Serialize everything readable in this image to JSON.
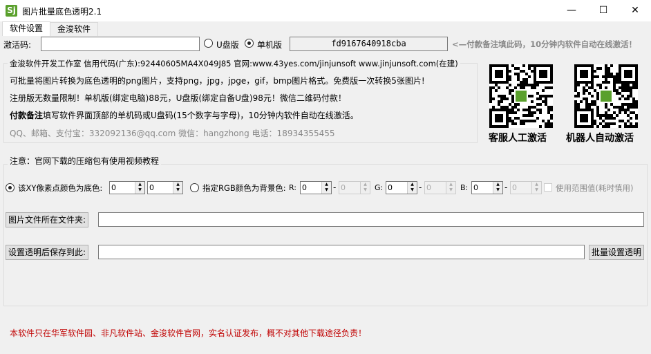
{
  "window": {
    "title": "图片批量底色透明2.1",
    "icon_text": "Sj",
    "minimize": "—",
    "maximize": "☐",
    "close": "✕"
  },
  "tabs": [
    {
      "label": "软件设置"
    },
    {
      "label": "金浚软件"
    }
  ],
  "activation": {
    "label": "激活码:",
    "value": "",
    "usb_label": "U盘版",
    "pc_label": "单机版",
    "selected": "单机版",
    "machine_code": "fd9167640918cba",
    "hint": "<—付款备注填此码，10分钟内软件自动在线激活！"
  },
  "info": {
    "legend": "金浚软件开发工作室 信用代码(广东):92440605MA4X049J85 官网:www.43yes.com/jinjunsoft  www.jinjunsoft.com(在建)",
    "line1": "可批量将图片转换为底色透明的png图片，支持png，jpg，jpge，gif，bmp图片格式。免费版一次转换5张图片!",
    "line2": "注册版无数量限制！单机版(绑定电脑)88元，U盘版(绑定自备U盘)98元！微信二维码付款！",
    "line3_bold": "付款备注",
    "line3_rest": "填写软件界面顶部的单机码或U盘码(15个数字与字母)，10分钟内软件自动在线激活。",
    "contact": "QQ、邮箱、支付宝：332092136@qq.com   微信：hangzhong   电话：18934355455",
    "qr1_label": "客服人工激活",
    "qr2_label": "机器人自动激活"
  },
  "settings": {
    "legend": "注意：官网下载的压缩包有使用视频教程",
    "radio_xy": "该XY像素点颜色为底色:",
    "x": "0",
    "y": "0",
    "radio_rgb": "指定RGB颜色为背景色:",
    "r_label": "R:",
    "g_label": "G:",
    "b_label": "B:",
    "r1": "0",
    "r2": "0",
    "g1": "0",
    "g2": "0",
    "b1": "0",
    "b2": "0",
    "dash": "-",
    "range_label": "使用范围值(耗时慎用)",
    "folder_btn": "图片文件所在文件夹:",
    "folder_value": "",
    "save_btn": "设置透明后保存到此:",
    "save_value": "",
    "batch_btn": "批量设置透明"
  },
  "footer": {
    "notice": "本软件只在华军软件园、非凡软件站、金浚软件官网，实名认证发布，概不对其他下载途径负责！",
    "color": "#c00000"
  }
}
